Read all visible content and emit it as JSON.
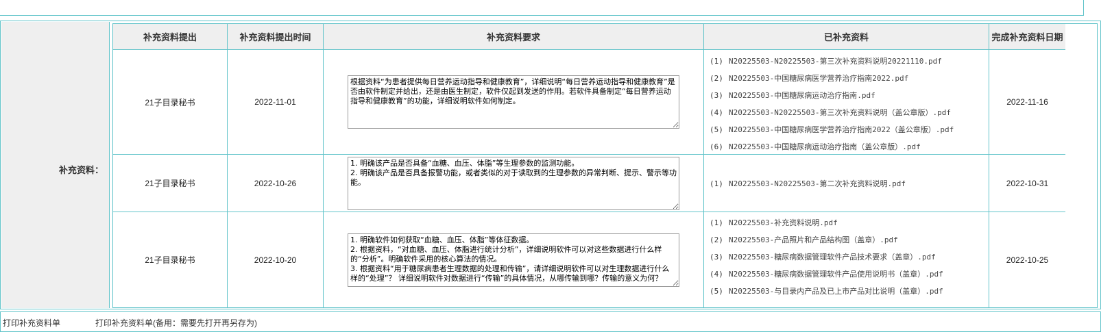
{
  "section_label": "补充资料：",
  "columns": [
    "补充资料提出",
    "补充资料提出时间",
    "补充资料要求",
    "已补充资料",
    "完成补充资料日期"
  ],
  "rows": [
    {
      "proposer": "21子目录秘书",
      "date": "2022-11-01",
      "requirement": "根据资料“为患者提供每日营养运动指导和健康教育”，详细说明“每日营养运动指导和健康教育”是否由软件制定并给出，还是由医生制定，软件仅起到发送的作用。若软件具备制定“每日营养运动指导和健康教育”的功能，详细说明软件如何制定。",
      "files": [
        {
          "num": "(1)",
          "name": "N20225503-N20225503-第三次补充资料说明20221110.pdf"
        },
        {
          "num": "(2)",
          "name": "N20225503-中国糖尿病医学营养治疗指南2022.pdf"
        },
        {
          "num": "(3)",
          "name": "N20225503-中国糖尿病运动治疗指南.pdf"
        },
        {
          "num": "(4)",
          "name": "N20225503-N20225503-第三次补充资料说明（盖公章版）.pdf"
        },
        {
          "num": "(5)",
          "name": "N20225503-中国糖尿病医学营养治疗指南2022（盖公章版）.pdf"
        },
        {
          "num": "(6)",
          "name": "N20225503-中国糖尿病运动治疗指南（盖公章版）.pdf"
        }
      ],
      "completed": "2022-11-16"
    },
    {
      "proposer": "21子目录秘书",
      "date": "2022-10-26",
      "requirement": "1. 明确该产品是否具备“血糖、血压、体脂”等生理参数的监测功能。\n2. 明确该产品是否具备报警功能，或者类似的对于读取到的生理参数的异常判断、提示、警示等功能。",
      "files": [
        {
          "num": "(1)",
          "name": "N20225503-N20225503-第二次补充资料说明.pdf"
        }
      ],
      "completed": "2022-10-31"
    },
    {
      "proposer": "21子目录秘书",
      "date": "2022-10-20",
      "requirement": "1. 明确软件如何获取“血糖、血压、体脂”等体征数据。\n2. 根据资料，“对血糖、血压、体脂进行统计分析”，详细说明软件可以对这些数据进行什么样的“分析”。明确软件采用的核心算法的情况。\n3. 根据资料“用于糖尿病患者生理数据的处理和传输”，请详细说明软件可以对生理数据进行什么样的“处理”？ 详细说明软件对数据进行“传输”的具体情况，从哪传输到哪？传输的意义为何？",
      "files": [
        {
          "num": "(1)",
          "name": "N20225503-补充资料说明.pdf"
        },
        {
          "num": "(2)",
          "name": "N20225503-产品照片和产品结构图（盖章）.pdf"
        },
        {
          "num": "(3)",
          "name": "N20225503-糖尿病数据管理软件产品技术要求（盖章）.pdf"
        },
        {
          "num": "(4)",
          "name": "N20225503-糖尿病数据管理软件产品使用说明书（盖章）.pdf"
        },
        {
          "num": "(5)",
          "name": "N20225503-与目录内产品及已上市产品对比说明（盖章）.pdf"
        }
      ],
      "completed": "2022-10-25"
    }
  ],
  "bottom": {
    "print_link": "打印补充资料单",
    "print_backup_link": "打印补充资料单(备用：需要先打开再另存为)"
  },
  "colors": {
    "border": "#5fc3c9",
    "header_bg": "#efefef"
  }
}
